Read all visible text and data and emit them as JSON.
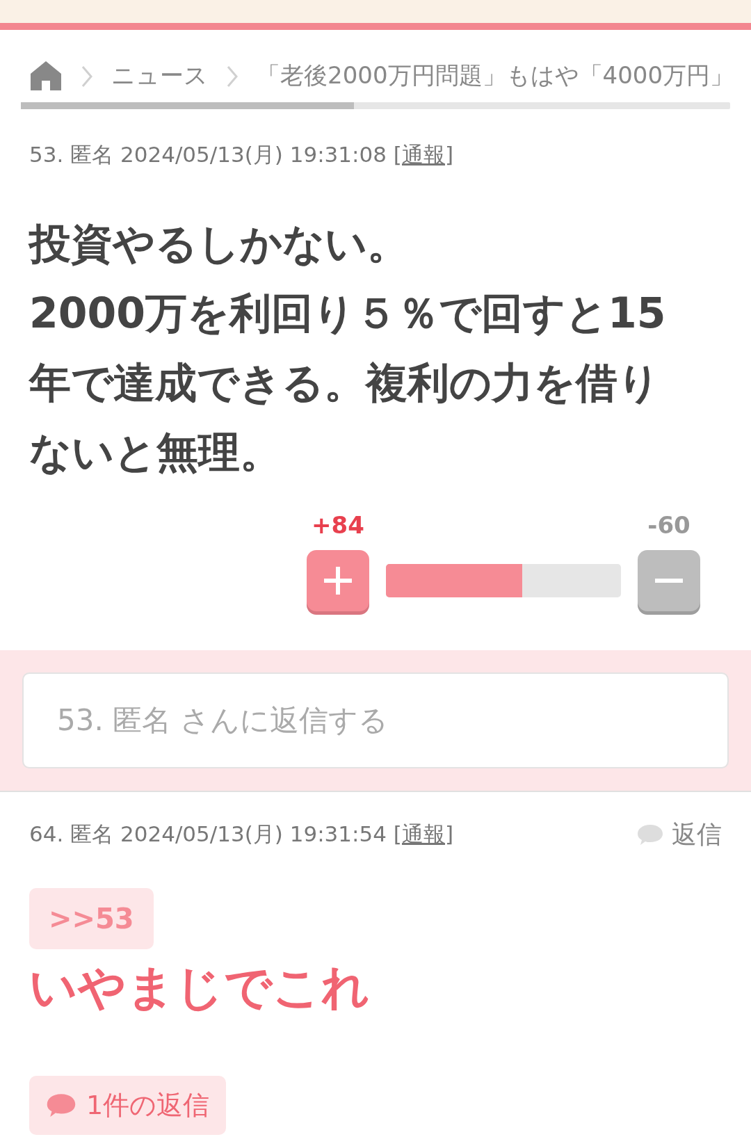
{
  "breadcrumb": [
    {
      "kind": "home"
    },
    {
      "kind": "text",
      "label": "ニュース"
    },
    {
      "kind": "text",
      "label": "「老後2000万円問題」もはや「4000万円」"
    }
  ],
  "comments": [
    {
      "number": "53.",
      "author": "匿名",
      "date": "2024/05/13(月) 19:31:08",
      "report": "[通報]",
      "body": "投資やるしかない。\n2000万を利回り５％で回すと15年で達成できる。複利の力を借りないと無理。",
      "votes": {
        "plus": "+84",
        "minus": "-60",
        "level": 0.58
      }
    },
    {
      "number": "64.",
      "author": "匿名",
      "date": "2024/05/13(月) 19:31:54",
      "report": "[通報]",
      "reply_link": "返信",
      "anchor": ">>53",
      "body": "いやまじでこれ",
      "replies": "1件の返信"
    }
  ],
  "reply_field": {
    "placeholder": "53. 匿名 さんに返信する"
  }
}
